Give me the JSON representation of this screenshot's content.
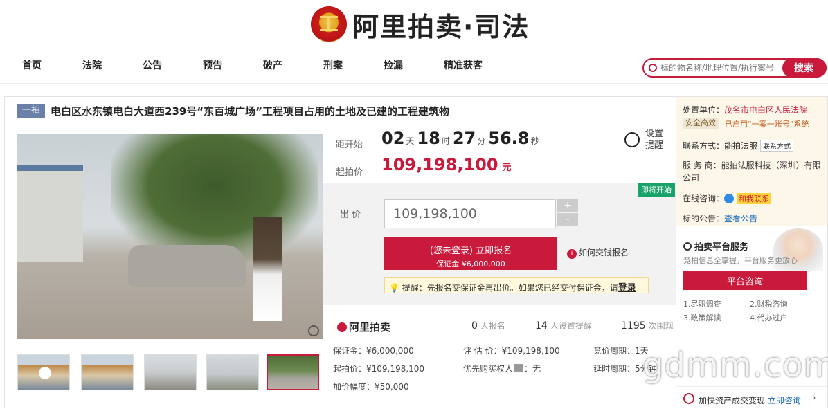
{
  "header": {
    "logo_text": "阿里拍卖·司法",
    "nav": [
      "首页",
      "法院",
      "公告",
      "预告",
      "破产",
      "刑案",
      "捡漏",
      "精准获客"
    ],
    "search_placeholder": "标的物名称/地理位置/执行案号",
    "search_button": "搜索"
  },
  "item": {
    "badge": "一拍",
    "title": "电白区水东镇电白大道西239号“东百城广场”工程项目占用的土地及已建的工程建筑物",
    "countdown_label": "距开始",
    "countdown": {
      "days": "02",
      "days_unit": "天",
      "hours": "18",
      "hours_unit": "时",
      "minutes": "27",
      "minutes_unit": "分",
      "seconds": "56.8",
      "seconds_unit": "秒"
    },
    "start_price_label": "起拍价",
    "start_price": "109,198,100",
    "currency_unit": "元",
    "remind_label": "设置提醒",
    "status_tag": "即将开始",
    "bid_label": "出 价",
    "bid_value": "109,198,100",
    "plus": "+",
    "minus": "-",
    "apply_main": "(您未登录) 立即报名",
    "apply_sub": "保证金 ¥6,000,000",
    "howto": "如何交钱报名",
    "howto_icon": "i",
    "tip_text": "提醒：先报名交保证金再出价。如果您已经交付保证金，请",
    "tip_link": "登录"
  },
  "stats": {
    "brand": "阿里拍卖",
    "signups": "0",
    "signups_label": "人报名",
    "reminders": "14",
    "reminders_label": "人设置提醒",
    "views": "1195",
    "views_label": "次围观"
  },
  "details": {
    "deposit": "保证金：¥6,000,000",
    "start": "起拍价：¥109,198,100",
    "increment": "加价幅度：¥50,000",
    "appraisal": "评 估 价：¥109,198,100",
    "priority": "优先购买权人",
    "priority_badge": "",
    "priority_value": "：无",
    "cycle": "竞价周期：1天",
    "delay": "延时周期：5分钟"
  },
  "side": {
    "unit_label": "处置单位：",
    "unit_value": "茂名市电白区人民法院",
    "safe_badge": "安全高效",
    "enabled": "已启用“一案一账号”系统",
    "contact_label": "联系方式：",
    "contact_value": "能拍法服",
    "contact_btn": "联系方式",
    "provider_label": "服 务 商：",
    "provider_value": "能拍法服科技（深圳）有限公司",
    "online_label": "在线咨询：",
    "online_btn": "和我联系",
    "notice_label": "标的公告：",
    "notice_link": "查看公告",
    "promo_title": "拍卖平台服务",
    "promo_sub": "竞拍信息全掌握，平台服务更放心",
    "consult_btn": "平台咨询",
    "services": [
      "1.尽职调查",
      "2.财税咨询",
      "3.政策解读",
      "4.代办过户"
    ],
    "footer_text": "加快资产成交变现",
    "footer_link": "立即咨询",
    "footer_arrow": "›"
  },
  "watermark": "gdmm.com"
}
